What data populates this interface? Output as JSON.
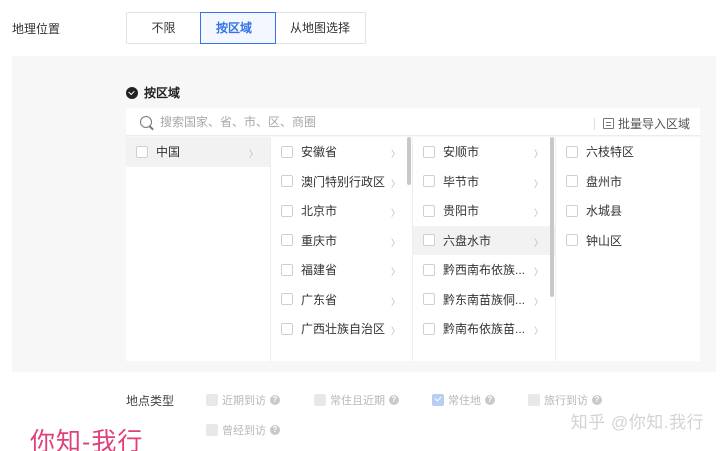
{
  "geo": {
    "label": "地理位置",
    "options": [
      "不限",
      "按区域",
      "从地图选择"
    ],
    "selected": "按区域"
  },
  "region": {
    "title": "按区域",
    "search_placeholder": "搜索国家、省、市、区、商圈",
    "import_label": "批量导入区域"
  },
  "cascader": {
    "countries": [
      {
        "label": "中国",
        "selected": true
      }
    ],
    "provinces": [
      {
        "label": "安徽省"
      },
      {
        "label": "澳门特别行政区"
      },
      {
        "label": "北京市"
      },
      {
        "label": "重庆市"
      },
      {
        "label": "福建省"
      },
      {
        "label": "广东省"
      },
      {
        "label": "广西壮族自治区"
      }
    ],
    "cities": [
      {
        "label": "安顺市"
      },
      {
        "label": "毕节市"
      },
      {
        "label": "贵阳市"
      },
      {
        "label": "六盘水市",
        "selected": true
      },
      {
        "label": "黔西南布依族..."
      },
      {
        "label": "黔东南苗族侗..."
      },
      {
        "label": "黔南布依族苗..."
      }
    ],
    "districts": [
      {
        "label": "六枝特区"
      },
      {
        "label": "盘州市"
      },
      {
        "label": "水城县"
      },
      {
        "label": "钟山区"
      }
    ]
  },
  "location_type": {
    "label": "地点类型",
    "options": [
      {
        "label": "近期到访",
        "checked": false
      },
      {
        "label": "常住且近期",
        "checked": false
      },
      {
        "label": "常住地",
        "checked": true
      },
      {
        "label": "旅行到访",
        "checked": false
      },
      {
        "label": "曾经到访",
        "checked": false
      }
    ]
  },
  "brand": "你知-我行",
  "watermark": "知乎 @你知.我行",
  "colors": {
    "accent": "#3773e6",
    "brand": "#e0417a",
    "panel_bg": "#f7f7f8"
  },
  "icons": [
    "check-circle-icon",
    "search-icon",
    "import-icon",
    "chevron-right-icon",
    "help-icon"
  ]
}
